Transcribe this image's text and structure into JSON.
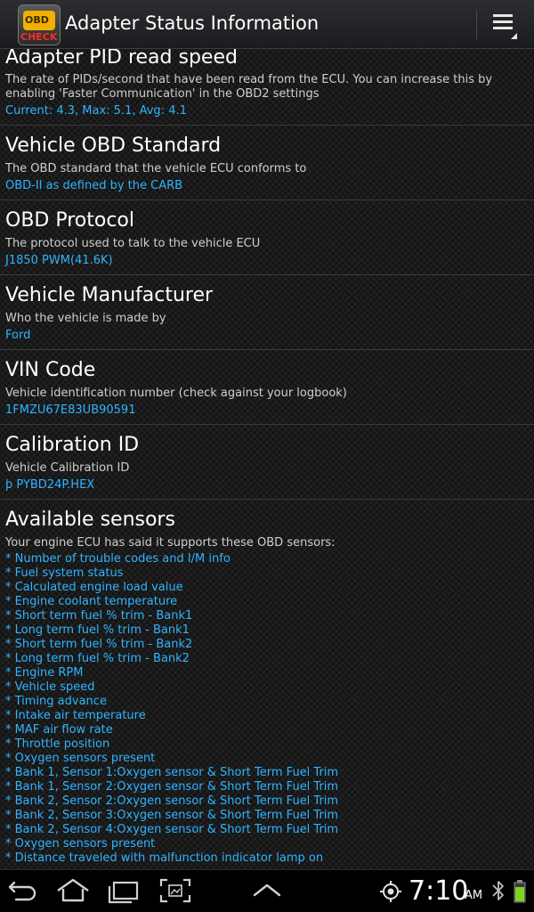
{
  "action_bar": {
    "title": "Adapter Status Information",
    "app_icon": {
      "obd_text": "OBD",
      "check_text": "CHECK",
      "icon": "obd-check-app-icon"
    },
    "menu_icon": "overflow-menu-icon"
  },
  "sections": [
    {
      "title": "Adapter PID read speed",
      "description": "The rate of PIDs/second that have been read from the ECU. You can increase this by enabling 'Faster Communication' in the OBD2 settings",
      "value": "Current: 4.3, Max: 5.1, Avg: 4.1"
    },
    {
      "title": "Vehicle OBD Standard",
      "description": "The OBD standard that the vehicle ECU conforms to",
      "value": "OBD-II as defined by the CARB"
    },
    {
      "title": "OBD Protocol",
      "description": "The protocol used to talk to the vehicle ECU",
      "value": "J1850 PWM(41.6K)"
    },
    {
      "title": "Vehicle Manufacturer",
      "description": "Who the vehicle is made by",
      "value": "Ford"
    },
    {
      "title": "VIN Code",
      "description": "Vehicle identification number (check against your logbook)",
      "value": "1FMZU67E83UB90591"
    },
    {
      "title": "Calibration ID",
      "description": "Vehicle Calibration ID",
      "value": "þ PYBD24P.HEX"
    },
    {
      "title": "Available sensors",
      "description": "Your engine ECU has said it supports these OBD sensors:",
      "sensors": [
        "* Number of trouble codes and I/M info",
        "* Fuel system status",
        "* Calculated engine load value",
        "* Engine coolant temperature",
        "* Short term fuel % trim - Bank1",
        "* Long term fuel % trim - Bank1",
        "* Short term fuel % trim - Bank2",
        "* Long term fuel % trim - Bank2",
        "* Engine RPM",
        "* Vehicle speed",
        "* Timing advance",
        "* Intake air temperature",
        "* MAF air flow rate",
        "* Throttle position",
        "* Oxygen sensors present",
        "* Bank 1, Sensor 1:Oxygen sensor & Short Term Fuel Trim",
        "* Bank 1, Sensor 2:Oxygen sensor & Short Term Fuel Trim",
        "* Bank 2, Sensor 2:Oxygen sensor & Short Term Fuel Trim",
        "* Bank 2, Sensor 3:Oxygen sensor & Short Term Fuel Trim",
        "* Bank 2, Sensor 4:Oxygen sensor & Short Term Fuel Trim",
        "* Oxygen sensors present",
        "* Distance traveled with malfunction indicator lamp on"
      ]
    }
  ],
  "system_bar": {
    "buttons": [
      "back-icon",
      "home-icon",
      "recent-apps-icon",
      "screenshot-icon",
      "expand-up-icon"
    ],
    "status_icons": [
      "gps-icon",
      "bluetooth-icon",
      "battery-icon"
    ],
    "time": "7:10",
    "ampm": "AM"
  },
  "colors": {
    "accent_value": "#2fb4ff",
    "title_text": "#ffffff",
    "description_text": "#cfcfcf",
    "battery_green": "#7fd321"
  }
}
